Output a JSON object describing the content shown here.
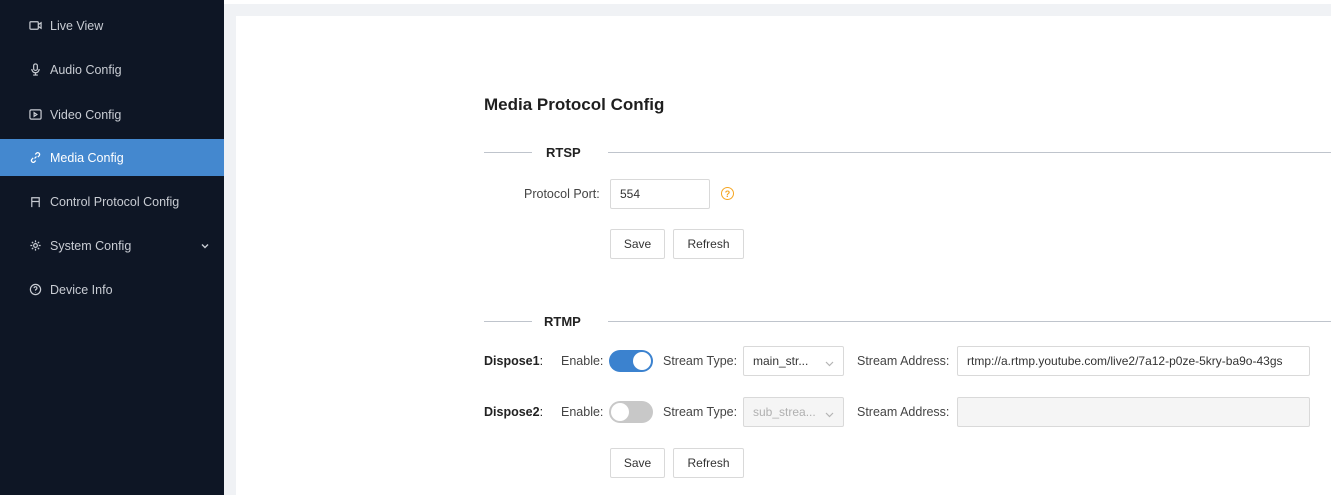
{
  "sidebar": {
    "items": [
      {
        "label": "Live View",
        "icon": "video-camera-icon"
      },
      {
        "label": "Audio Config",
        "icon": "microphone-icon"
      },
      {
        "label": "Video Config",
        "icon": "video-play-icon"
      },
      {
        "label": "Media Config",
        "icon": "link-icon",
        "active": true
      },
      {
        "label": "Control Protocol Config",
        "icon": "control-icon"
      },
      {
        "label": "System Config",
        "icon": "gear-icon",
        "has_children": true
      },
      {
        "label": "Device Info",
        "icon": "info-circle-icon"
      }
    ]
  },
  "main": {
    "title": "Media Protocol Config",
    "rtsp": {
      "section_label": "RTSP",
      "port_label": "Protocol Port:",
      "port_value": "554",
      "help_icon": "question-circle-icon",
      "save_label": "Save",
      "refresh_label": "Refresh"
    },
    "rtmp": {
      "section_label": "RTMP",
      "dispose1": {
        "label": "Dispose1",
        "colon": ":",
        "enable_label": "Enable:",
        "enabled": true,
        "stream_type_label": "Stream Type:",
        "stream_type_value": "main_str...",
        "stream_address_label": "Stream Address:",
        "stream_address_value": "rtmp://a.rtmp.youtube.com/live2/7a12-p0ze-5kry-ba9o-43gs"
      },
      "dispose2": {
        "label": "Dispose2",
        "colon": ":",
        "enable_label": "Enable:",
        "enabled": false,
        "stream_type_label": "Stream Type:",
        "stream_type_value": "sub_strea...",
        "stream_address_label": "Stream Address:",
        "stream_address_value": ""
      },
      "save_label": "Save",
      "refresh_label": "Refresh"
    }
  },
  "colors": {
    "sidebar_bg": "#0e1625",
    "active_item": "#4488cf",
    "switch_on": "#3b82cf",
    "help_icon": "#f5a623"
  }
}
